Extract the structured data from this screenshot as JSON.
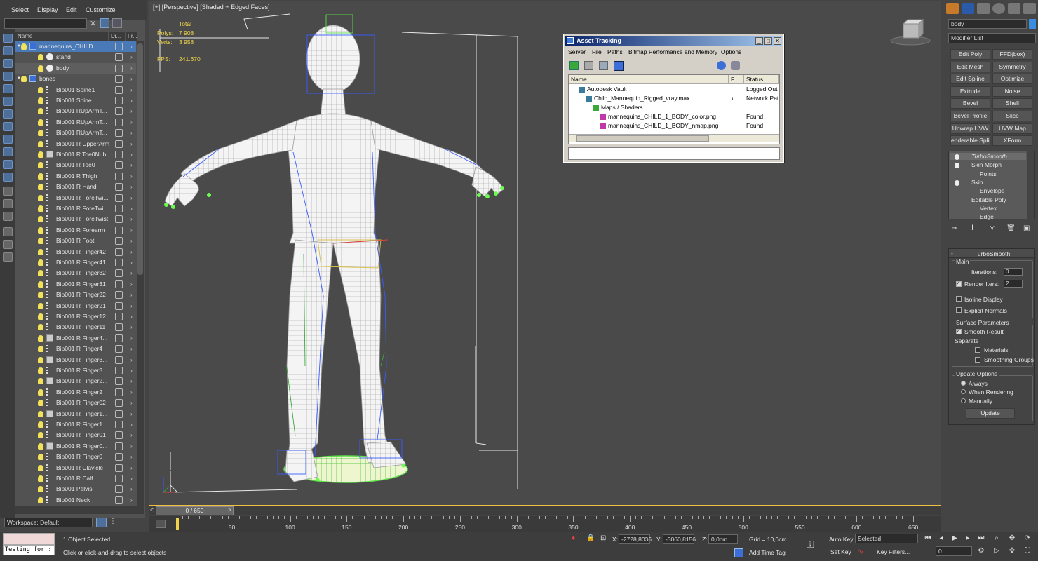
{
  "menu": {
    "items": [
      "Select",
      "Display",
      "Edit",
      "Customize"
    ]
  },
  "explorer": {
    "columns": {
      "name": "Name",
      "display": "Di...",
      "freeze": "Fr..."
    },
    "rows": [
      {
        "label": "mannequins_CHILD",
        "indent": 0,
        "kind": "layer",
        "state": "sel"
      },
      {
        "label": "stand",
        "indent": 1,
        "kind": "sphere",
        "state": ""
      },
      {
        "label": "body",
        "indent": 1,
        "kind": "sphere",
        "state": "hl"
      },
      {
        "label": "bones",
        "indent": 0,
        "kind": "layer",
        "state": ""
      },
      {
        "label": "Bip001 Spine1",
        "indent": 1,
        "kind": "bone",
        "state": ""
      },
      {
        "label": "Bip001 Spine",
        "indent": 1,
        "kind": "bone",
        "state": ""
      },
      {
        "label": "Bip001 RUpArmT...",
        "indent": 1,
        "kind": "bone",
        "state": ""
      },
      {
        "label": "Bip001 RUpArmT...",
        "indent": 1,
        "kind": "bone",
        "state": ""
      },
      {
        "label": "Bip001 RUpArmT...",
        "indent": 1,
        "kind": "bone",
        "state": ""
      },
      {
        "label": "Bip001 R UpperArm",
        "indent": 1,
        "kind": "bone",
        "state": ""
      },
      {
        "label": "Bip001 R Toe0Nub",
        "indent": 1,
        "kind": "point",
        "state": ""
      },
      {
        "label": "Bip001 R Toe0",
        "indent": 1,
        "kind": "bone",
        "state": ""
      },
      {
        "label": "Bip001 R Thigh",
        "indent": 1,
        "kind": "bone",
        "state": ""
      },
      {
        "label": "Bip001 R Hand",
        "indent": 1,
        "kind": "bone",
        "state": ""
      },
      {
        "label": "Bip001 R ForeTwi...",
        "indent": 1,
        "kind": "bone",
        "state": ""
      },
      {
        "label": "Bip001 R ForeTwi...",
        "indent": 1,
        "kind": "bone",
        "state": ""
      },
      {
        "label": "Bip001 R ForeTwist",
        "indent": 1,
        "kind": "bone",
        "state": ""
      },
      {
        "label": "Bip001 R Forearm",
        "indent": 1,
        "kind": "bone",
        "state": ""
      },
      {
        "label": "Bip001 R Foot",
        "indent": 1,
        "kind": "bone",
        "state": ""
      },
      {
        "label": "Bip001 R Finger42",
        "indent": 1,
        "kind": "bone",
        "state": ""
      },
      {
        "label": "Bip001 R Finger41",
        "indent": 1,
        "kind": "bone",
        "state": ""
      },
      {
        "label": "Bip001 R Finger32",
        "indent": 1,
        "kind": "bone",
        "state": ""
      },
      {
        "label": "Bip001 R Finger31",
        "indent": 1,
        "kind": "bone",
        "state": ""
      },
      {
        "label": "Bip001 R Finger22",
        "indent": 1,
        "kind": "bone",
        "state": ""
      },
      {
        "label": "Bip001 R Finger21",
        "indent": 1,
        "kind": "bone",
        "state": ""
      },
      {
        "label": "Bip001 R Finger12",
        "indent": 1,
        "kind": "bone",
        "state": ""
      },
      {
        "label": "Bip001 R Finger11",
        "indent": 1,
        "kind": "bone",
        "state": ""
      },
      {
        "label": "Bip001 R Finger4...",
        "indent": 1,
        "kind": "point",
        "state": ""
      },
      {
        "label": "Bip001 R Finger4",
        "indent": 1,
        "kind": "bone",
        "state": ""
      },
      {
        "label": "Bip001 R Finger3...",
        "indent": 1,
        "kind": "point",
        "state": ""
      },
      {
        "label": "Bip001 R Finger3",
        "indent": 1,
        "kind": "bone",
        "state": ""
      },
      {
        "label": "Bip001 R Finger2...",
        "indent": 1,
        "kind": "point",
        "state": ""
      },
      {
        "label": "Bip001 R Finger2",
        "indent": 1,
        "kind": "bone",
        "state": ""
      },
      {
        "label": "Bip001 R Finger02",
        "indent": 1,
        "kind": "bone",
        "state": ""
      },
      {
        "label": "Bip001 R Finger1...",
        "indent": 1,
        "kind": "point",
        "state": ""
      },
      {
        "label": "Bip001 R Finger1",
        "indent": 1,
        "kind": "bone",
        "state": ""
      },
      {
        "label": "Bip001 R Finger01",
        "indent": 1,
        "kind": "bone",
        "state": ""
      },
      {
        "label": "Bip001 R Finger0...",
        "indent": 1,
        "kind": "point",
        "state": ""
      },
      {
        "label": "Bip001 R Finger0",
        "indent": 1,
        "kind": "bone",
        "state": ""
      },
      {
        "label": "Bip001 R Clavicle",
        "indent": 1,
        "kind": "bone",
        "state": ""
      },
      {
        "label": "Bip001 R Calf",
        "indent": 1,
        "kind": "bone",
        "state": ""
      },
      {
        "label": "Bip001 Pelvis",
        "indent": 1,
        "kind": "bone",
        "state": ""
      },
      {
        "label": "Bip001 Neck",
        "indent": 1,
        "kind": "bone",
        "state": ""
      }
    ],
    "workspace": "Workspace: Default"
  },
  "viewport": {
    "label": "[+] [Perspective] [Shaded + Edged Faces]",
    "stats": {
      "total": "Total",
      "polys_label": "Polys:",
      "polys": "7 908",
      "verts_label": "Verts:",
      "verts": "3 958",
      "fps_label": "FPS:",
      "fps": "241.670"
    },
    "colors": {
      "mesh": "#f2f2f2",
      "wire": "#9a9a9a",
      "selected": "#6aff4f",
      "bones": "#3a5cff",
      "frame": "#f0c040"
    }
  },
  "asset_tracking": {
    "title": "Asset Tracking",
    "menu": [
      "Server",
      "File",
      "Paths",
      "Bitmap Performance and Memory",
      "Options"
    ],
    "columns": [
      "Name",
      "F...",
      "Status"
    ],
    "rows": [
      {
        "name": "Autodesk Vault",
        "f": "",
        "status": "Logged Out (",
        "indent": 1
      },
      {
        "name": "Child_Mannequin_Rigged_vray.max",
        "f": "\\...",
        "status": "Network Path",
        "indent": 2
      },
      {
        "name": "Maps / Shaders",
        "f": "",
        "status": "",
        "indent": 3
      },
      {
        "name": "mannequins_CHILD_1_BODY_color.png",
        "f": "",
        "status": "Found",
        "indent": 4
      },
      {
        "name": "mannequins_CHILD_1_BODY_nmap.png",
        "f": "",
        "status": "Found",
        "indent": 4
      }
    ]
  },
  "command_panel": {
    "object_name": "body",
    "modifier_list": "Modifier List",
    "buttons": [
      "Edit Poly",
      "FFD(box)",
      "Edit Mesh",
      "Symmetry",
      "Edit Spline",
      "Optimize",
      "Extrude",
      "Noise",
      "Bevel",
      "Shell",
      "Bevel Profile",
      "Slice",
      "Unwrap UVW",
      "UVW Map",
      "enderable Splin",
      "XForm"
    ],
    "stack": [
      {
        "label": "TurboSmooth",
        "level": 0,
        "italic": true
      },
      {
        "label": "Skin Morph",
        "level": 0,
        "italic": false
      },
      {
        "label": "Points",
        "level": 1,
        "italic": false
      },
      {
        "label": "Skin",
        "level": 0,
        "italic": false
      },
      {
        "label": "Envelope",
        "level": 1,
        "italic": false
      },
      {
        "label": "Editable Poly",
        "level": 0,
        "italic": false
      },
      {
        "label": "Vertex",
        "level": 1,
        "italic": false
      },
      {
        "label": "Edge",
        "level": 1,
        "italic": false
      }
    ],
    "turbosmooth": {
      "title": "TurboSmooth",
      "main": "Main",
      "iterations_label": "Iterations:",
      "iterations": "0",
      "render_iters_label": "Render Iters:",
      "render_iters": "2",
      "isoline": "Isoline Display",
      "explicit_normals": "Explicit Normals",
      "surface_params": "Surface Parameters",
      "smooth_result": "Smooth Result",
      "separate": "Separate",
      "materials": "Materials",
      "smoothing_groups": "Smoothing Groups",
      "update_options": "Update Options",
      "always": "Always",
      "when_rendering": "When Rendering",
      "manually": "Manually",
      "update": "Update"
    }
  },
  "timeline": {
    "frame": "0 / 650",
    "ticks": [
      "50",
      "100",
      "150",
      "200",
      "250",
      "300",
      "350",
      "400",
      "450",
      "500",
      "550",
      "600",
      "650"
    ]
  },
  "status": {
    "testing": "Testing for :",
    "selected": "1 Object Selected",
    "hint": "Click or click-and-drag to select objects",
    "x_label": "X:",
    "x": "-2728,8036",
    "y_label": "Y:",
    "y": "-3060,8156",
    "z_label": "Z:",
    "z": "0,0cm",
    "grid": "Grid = 10,0cm",
    "add_time_tag": "Add Time Tag",
    "auto_key": "Auto Key",
    "set_key": "Set Key",
    "selected_dd": "Selected",
    "key_filters": "Key Filters...",
    "frame_field": "0"
  }
}
